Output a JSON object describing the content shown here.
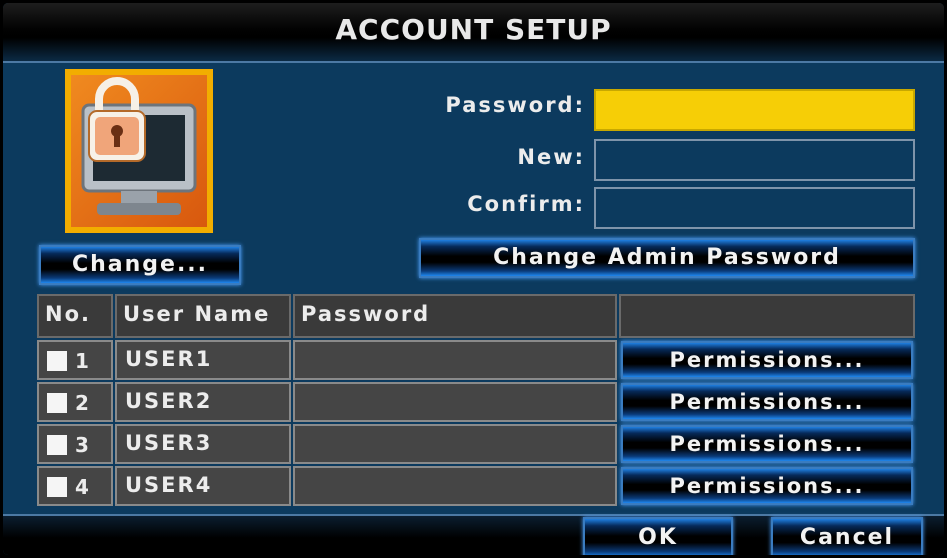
{
  "dialog": {
    "title": "ACCOUNT SETUP"
  },
  "profile": {
    "icon": "locked-monitor-icon",
    "change_label": "Change..."
  },
  "admin": {
    "password_label": "Password:",
    "new_label": "New:",
    "confirm_label": "Confirm:",
    "password_value": "",
    "new_value": "",
    "confirm_value": "",
    "change_admin_label": "Change Admin Password"
  },
  "table": {
    "headers": [
      "No.",
      "User Name",
      "Password",
      ""
    ],
    "rows": [
      {
        "no": "1",
        "checked": false,
        "user": "USER1",
        "password": "",
        "action": "Permissions..."
      },
      {
        "no": "2",
        "checked": false,
        "user": "USER2",
        "password": "",
        "action": "Permissions..."
      },
      {
        "no": "3",
        "checked": false,
        "user": "USER3",
        "password": "",
        "action": "Permissions..."
      },
      {
        "no": "4",
        "checked": false,
        "user": "USER4",
        "password": "",
        "action": "Permissions..."
      }
    ]
  },
  "footer": {
    "ok_label": "OK",
    "cancel_label": "Cancel"
  },
  "colors": {
    "background": "#0c3a5e",
    "active_field": "#f6ce06",
    "icon_frame": "#f2ad00"
  }
}
